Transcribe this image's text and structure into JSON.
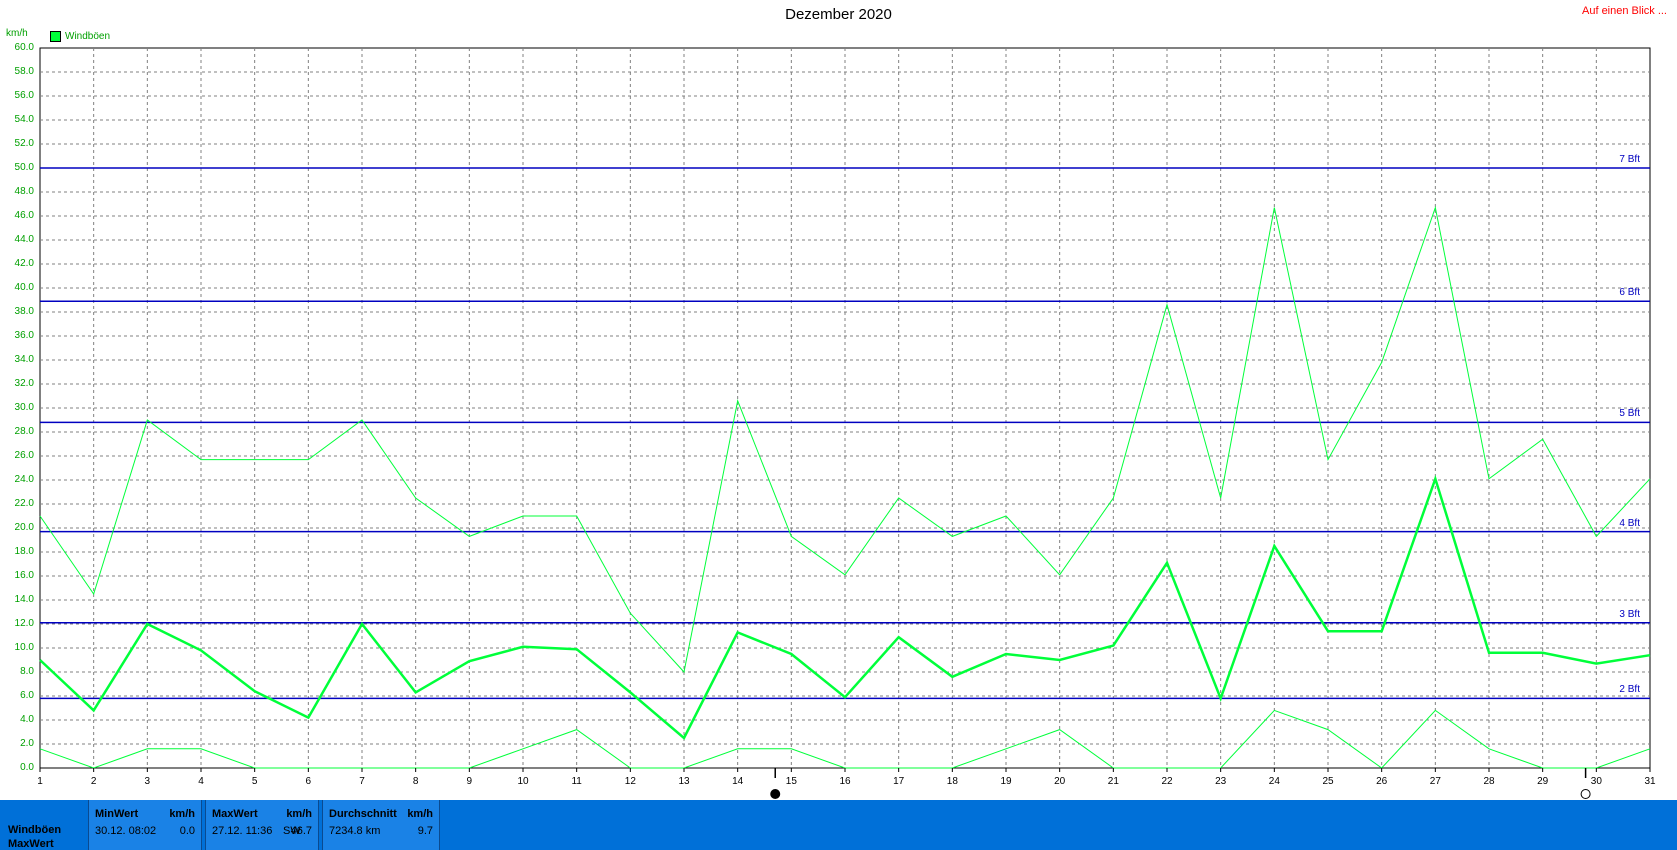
{
  "header": {
    "title": "Dezember 2020",
    "link_label": "Auf einen Blick ...",
    "unit": "km/h",
    "legend_label": "Windböen"
  },
  "colors": {
    "series": "#00ff3a",
    "beaufort": "#0000c0",
    "axis_labels": "#00a000",
    "footer": "#0070d8"
  },
  "chart_data": {
    "type": "line",
    "x": [
      1,
      2,
      3,
      4,
      5,
      6,
      7,
      8,
      9,
      10,
      11,
      12,
      13,
      14,
      15,
      16,
      17,
      18,
      19,
      20,
      21,
      22,
      23,
      24,
      25,
      26,
      27,
      28,
      29,
      30,
      31
    ],
    "ylim": [
      0,
      60
    ],
    "yticks": [
      "0.0",
      "2.0",
      "4.0",
      "6.0",
      "8.0",
      "10.0",
      "12.0",
      "14.0",
      "16.0",
      "18.0",
      "20.0",
      "22.0",
      "24.0",
      "26.0",
      "28.0",
      "30.0",
      "32.0",
      "34.0",
      "36.0",
      "38.0",
      "40.0",
      "42.0",
      "44.0",
      "46.0",
      "48.0",
      "50.0",
      "52.0",
      "54.0",
      "56.0",
      "58.0",
      "60.0"
    ],
    "xticks": [
      "1",
      "2",
      "3",
      "4",
      "5",
      "6",
      "7",
      "8",
      "9",
      "10",
      "11",
      "12",
      "13",
      "14",
      "15",
      "16",
      "17",
      "18",
      "19",
      "20",
      "21",
      "22",
      "23",
      "24",
      "25",
      "26",
      "27",
      "28",
      "29",
      "30",
      "31"
    ],
    "grid": true,
    "series": [
      {
        "name": "Windböen",
        "role": "max",
        "values": [
          21.0,
          14.5,
          29.0,
          25.7,
          25.7,
          25.7,
          29.0,
          22.5,
          19.3,
          21.0,
          21.0,
          12.9,
          8.0,
          30.6,
          19.3,
          16.1,
          22.5,
          19.3,
          21.0,
          16.1,
          22.5,
          38.6,
          22.5,
          46.7,
          25.7,
          33.8,
          46.7,
          24.1,
          27.4,
          19.3,
          24.1
        ]
      },
      {
        "name": "",
        "role": "avg",
        "values": [
          9.0,
          4.8,
          12.0,
          9.8,
          6.4,
          4.2,
          12.0,
          6.3,
          8.9,
          10.1,
          9.9,
          6.3,
          2.5,
          11.3,
          9.5,
          5.9,
          10.9,
          7.6,
          9.5,
          9.0,
          10.2,
          17.1,
          5.8,
          18.5,
          11.4,
          11.4,
          24.1,
          9.6,
          9.6,
          8.7,
          9.4
        ]
      },
      {
        "name": "",
        "role": "min",
        "values": [
          1.6,
          0.0,
          1.6,
          1.6,
          0.0,
          0.0,
          0.0,
          0.0,
          0.0,
          1.6,
          3.2,
          0.0,
          0.0,
          1.6,
          1.6,
          0.0,
          0.0,
          0.0,
          1.6,
          3.2,
          0.0,
          0.0,
          0.0,
          4.8,
          3.2,
          0.0,
          4.8,
          1.6,
          0.0,
          0.0,
          1.6
        ]
      }
    ],
    "beaufort": [
      {
        "label": "2 Bft",
        "value": 5.8
      },
      {
        "label": "3 Bft",
        "value": 12.1
      },
      {
        "label": "4 Bft",
        "value": 19.7
      },
      {
        "label": "5 Bft",
        "value": 28.8
      },
      {
        "label": "6 Bft",
        "value": 38.9
      },
      {
        "label": "7 Bft",
        "value": 50.0
      }
    ],
    "moon_phases": [
      {
        "day": 14.7,
        "icon": "full-moon-icon"
      },
      {
        "day": 29.8,
        "icon": "new-moon-icon"
      }
    ]
  },
  "footer": {
    "row1": "Windböen",
    "row2": "MaxWert",
    "min": {
      "title": "MinWert",
      "unit": "km/h",
      "time": "30.12.  08:02",
      "value": "0.0"
    },
    "max": {
      "title": "MaxWert",
      "unit": "km/h",
      "time": "27.12.  11:36",
      "dir": "SW",
      "value": "46.7"
    },
    "avg": {
      "title": "Durchschnitt",
      "unit": "km/h",
      "distance": "7234.8 km",
      "value": "9.7"
    }
  }
}
